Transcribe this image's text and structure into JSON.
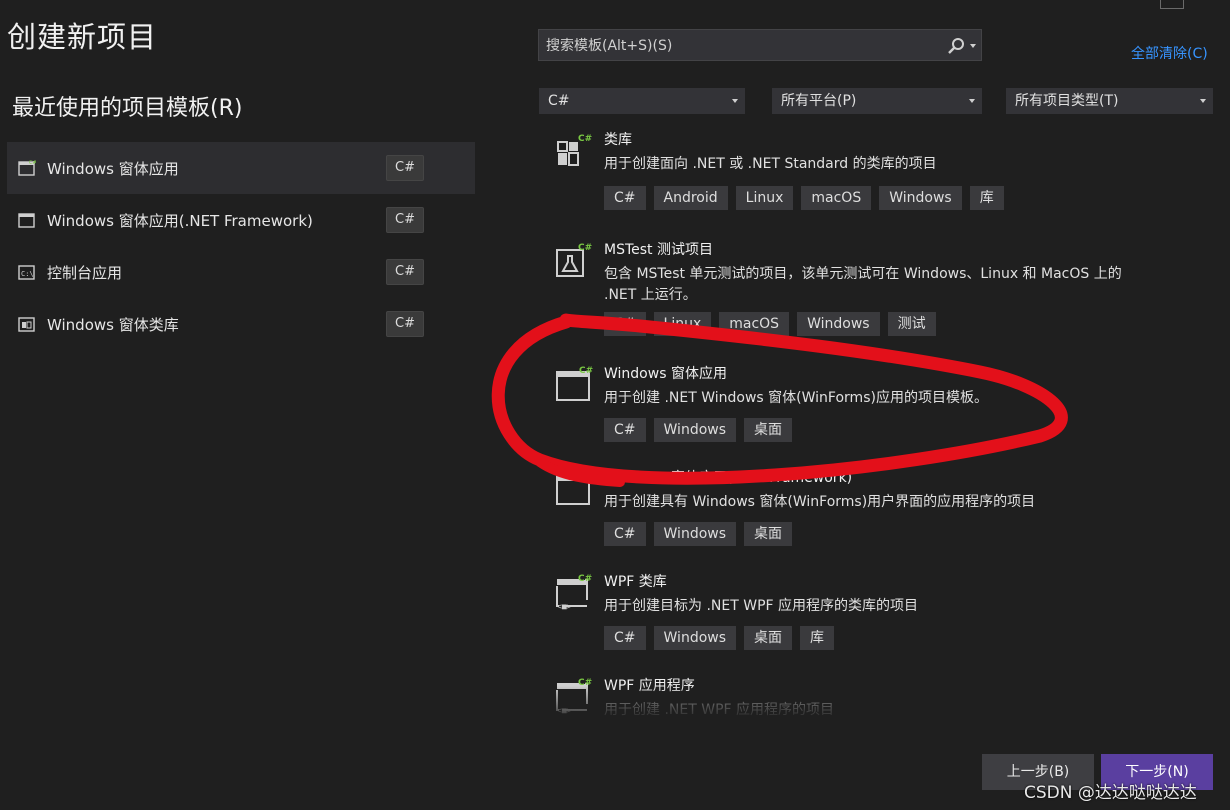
{
  "page": {
    "title": "创建新项目"
  },
  "recent": {
    "heading": "最近使用的项目模板(R)",
    "items": [
      {
        "label": "Windows 窗体应用",
        "lang": "C#"
      },
      {
        "label": "Windows 窗体应用(.NET Framework)",
        "lang": "C#"
      },
      {
        "label": "控制台应用",
        "lang": "C#"
      },
      {
        "label": "Windows 窗体类库",
        "lang": "C#"
      }
    ]
  },
  "search": {
    "placeholder": "搜索模板(Alt+S)(S)"
  },
  "clear_all": "全部清除(C)",
  "filters": {
    "language": "C#",
    "platform": "所有平台(P)",
    "project_type": "所有项目类型(T)"
  },
  "templates": [
    {
      "name": "类库",
      "description": "用于创建面向 .NET 或 .NET Standard 的类库的项目",
      "tags": [
        "C#",
        "Android",
        "Linux",
        "macOS",
        "Windows",
        "库"
      ]
    },
    {
      "name": "MSTest 测试项目",
      "description": "包含 MSTest 单元测试的项目，该单元测试可在 Windows、Linux 和 MacOS 上的 .NET 上运行。",
      "tags": [
        "C#",
        "Linux",
        "macOS",
        "Windows",
        "测试"
      ]
    },
    {
      "name": "Windows 窗体应用",
      "description": "用于创建 .NET Windows 窗体(WinForms)应用的项目模板。",
      "tags": [
        "C#",
        "Windows",
        "桌面"
      ]
    },
    {
      "name": "Windows 窗体应用(.NET Framework)",
      "description": "用于创建具有 Windows 窗体(WinForms)用户界面的应用程序的项目",
      "tags": [
        "C#",
        "Windows",
        "桌面"
      ]
    },
    {
      "name": "WPF 类库",
      "description": "用于创建目标为 .NET WPF 应用程序的类库的项目",
      "tags": [
        "C#",
        "Windows",
        "桌面",
        "库"
      ]
    },
    {
      "name": "WPF 应用程序",
      "description": "用于创建 .NET WPF 应用程序的项目",
      "tags": []
    }
  ],
  "buttons": {
    "back": "上一步(B)",
    "next": "下一步(N)"
  },
  "watermark": "CSDN @达达哒哒达达",
  "colors": {
    "background": "#1f1f1f",
    "accent_link": "#3794ff",
    "primary_button": "#5a3fa0",
    "annotation": "#e3101a"
  }
}
